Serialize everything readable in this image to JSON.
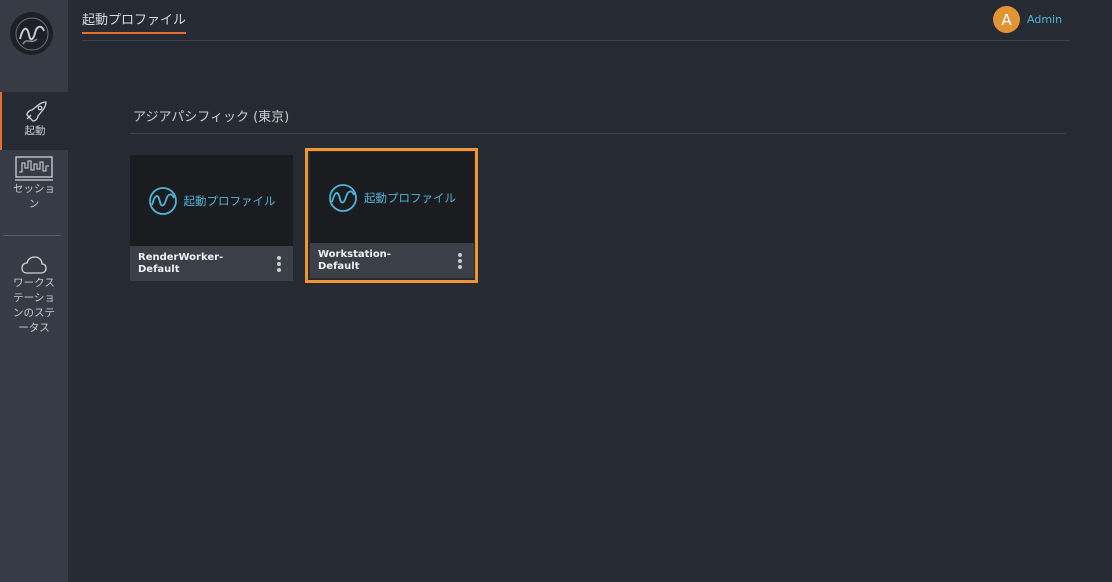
{
  "header": {
    "title": "起動プロファイル",
    "user": {
      "initial": "A",
      "name": "Admin"
    }
  },
  "sidebar": {
    "items": [
      {
        "label": "起動",
        "icon": "rocket-icon",
        "active": true
      },
      {
        "label": "セッション",
        "icon": "session-monitor-icon",
        "active": false
      },
      {
        "label": "ワークステーションのステータス",
        "icon": "cloud-icon",
        "active": false
      }
    ]
  },
  "main": {
    "region": "アジアパシフィック (東京)",
    "profiles": [
      {
        "thumb_label": "起動プロファイル",
        "name": "RenderWorker-Default",
        "selected": false
      },
      {
        "thumb_label": "起動プロファイル",
        "name": "Workstation-Default",
        "selected": true
      }
    ]
  },
  "colors": {
    "accent": "#e56b2f",
    "selection": "#f29531",
    "link": "#4fb3d8",
    "avatar": "#e19433"
  }
}
